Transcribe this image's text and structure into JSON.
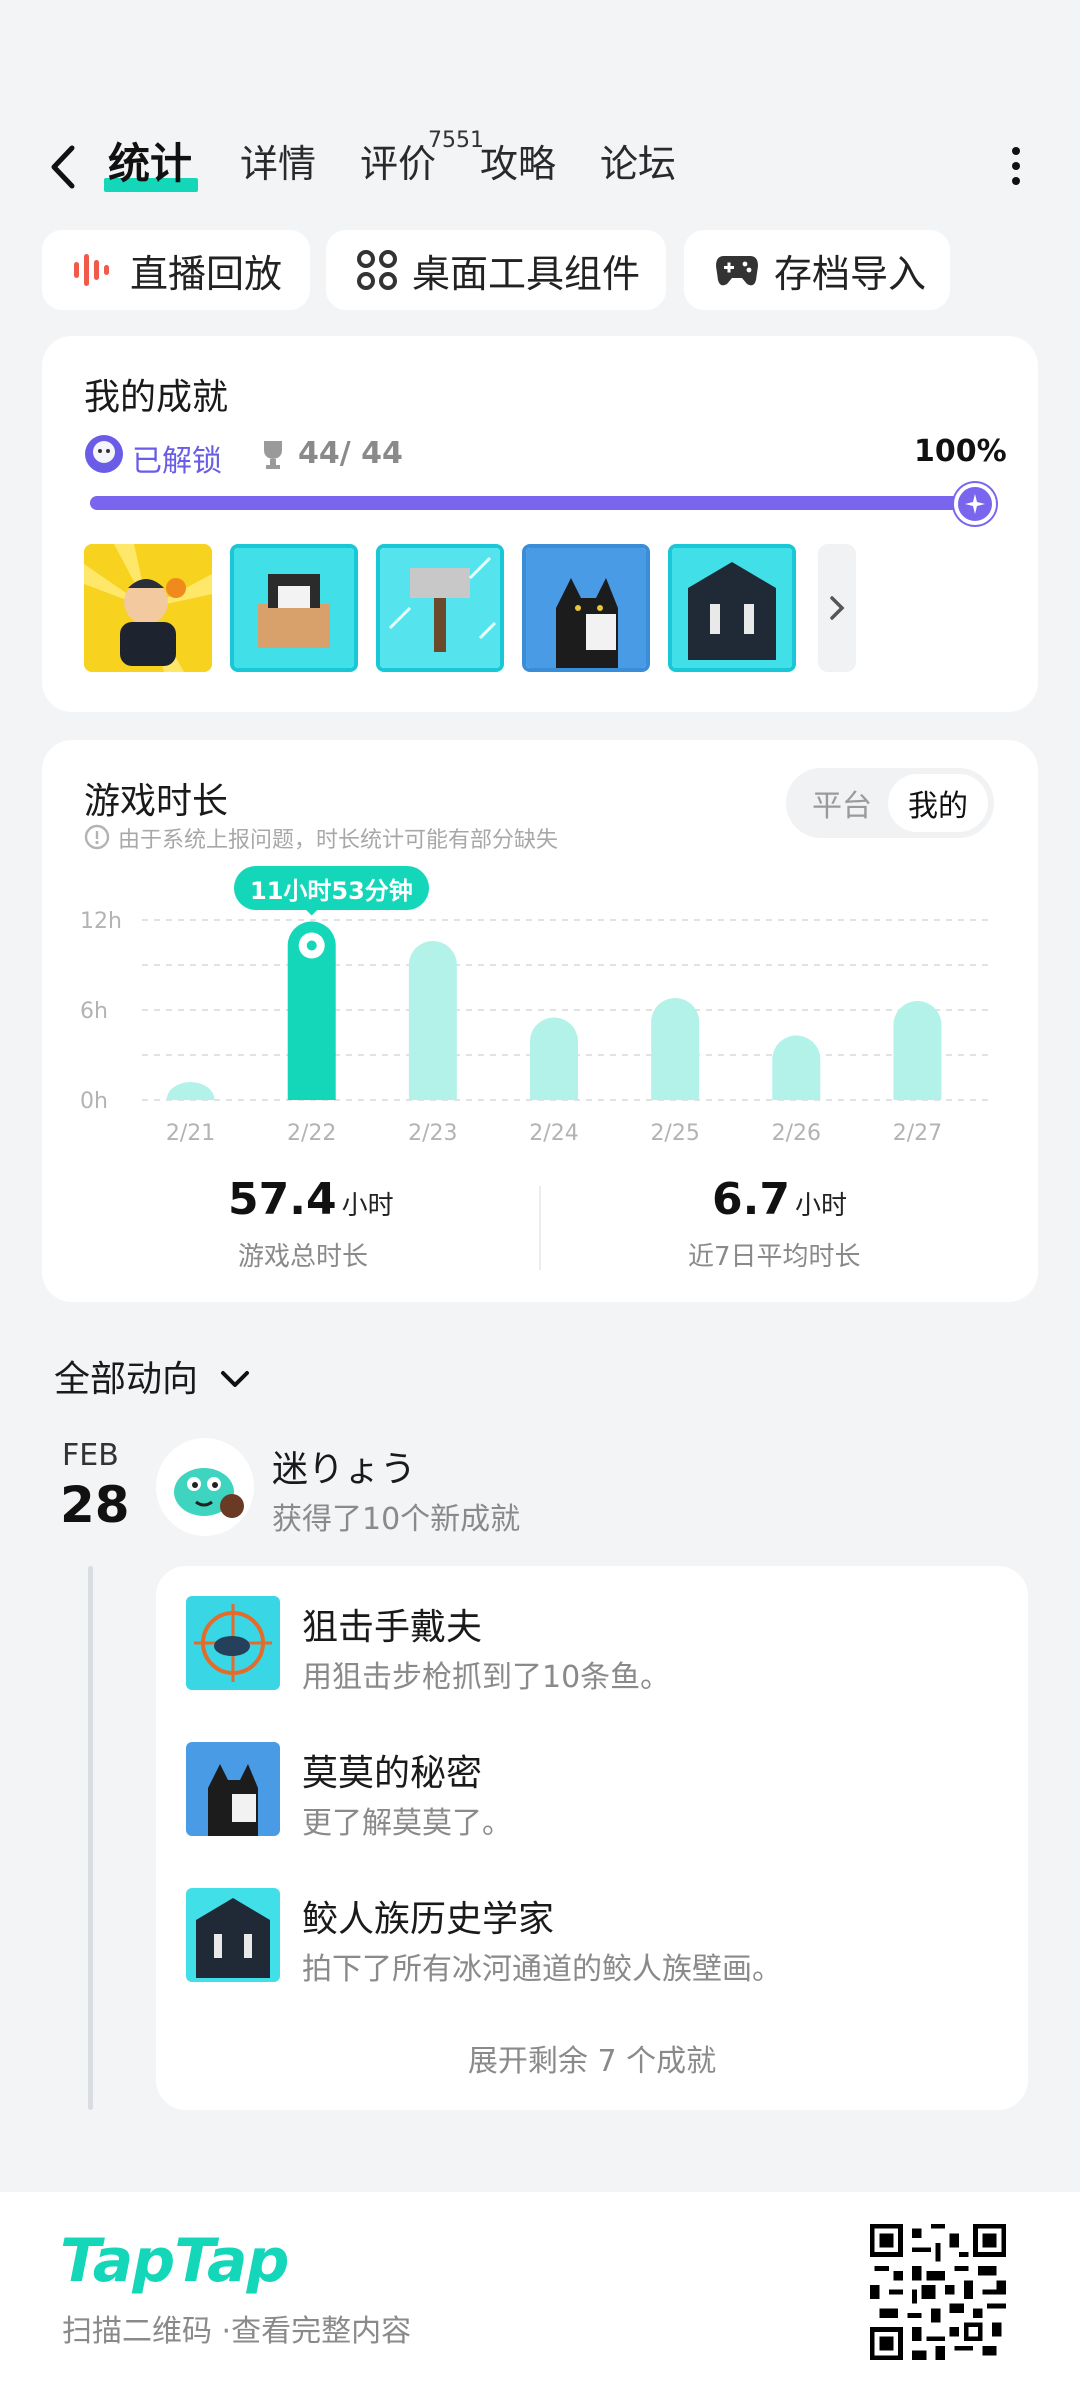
{
  "header": {
    "tabs": [
      {
        "label": "统计"
      },
      {
        "label": "详情"
      },
      {
        "label": "评价"
      },
      {
        "label": "攻略"
      },
      {
        "label": "论坛"
      }
    ],
    "review_count": "7551"
  },
  "chips": [
    {
      "label": "直播回放",
      "icon": "soundwave-icon"
    },
    {
      "label": "桌面工具组件",
      "icon": "widgets-icon"
    },
    {
      "label": "存档导入",
      "icon": "gamepad-icon"
    }
  ],
  "achievements": {
    "title": "我的成就",
    "status": "已解锁",
    "count": "44/ 44",
    "percent_label": "100%",
    "progress": 1.0
  },
  "playtime": {
    "title": "游戏时长",
    "note": "由于系统上报问题，时长统计可能有部分缺失",
    "toggle": {
      "platform": "平台",
      "mine": "我的"
    },
    "tooltip": "11小时53分钟",
    "total_value": "57.4",
    "total_unit": "小时",
    "total_label": "游戏总时长",
    "avg_value": "6.7",
    "avg_unit": "小时",
    "avg_label": "近7日平均时长"
  },
  "chart_data": {
    "type": "bar",
    "categories": [
      "2/21",
      "2/22",
      "2/23",
      "2/24",
      "2/25",
      "2/26",
      "2/27"
    ],
    "values": [
      1.2,
      11.9,
      10.6,
      5.5,
      6.8,
      4.3,
      6.6
    ],
    "yticks": [
      "12h",
      "6h",
      "0h"
    ],
    "ylim": [
      0,
      12
    ],
    "highlight_index": 1,
    "colors": {
      "highlight": "#14d6b8",
      "normal": "#b3f2e8"
    }
  },
  "feed": {
    "filter_label": "全部动向",
    "date_month": "FEB",
    "date_day": "28",
    "user_name": "迷りょう",
    "user_action": "获得了10个新成就",
    "items": [
      {
        "title": "狙击手戴夫",
        "desc": "用狙击步枪抓到了10条鱼。"
      },
      {
        "title": "莫莫的秘密",
        "desc": "更了解莫莫了。"
      },
      {
        "title": "鲛人族历史学家",
        "desc": "拍下了所有冰河通道的鲛人族壁画。"
      }
    ],
    "expand_label": "展开剩余 7 个成就"
  },
  "footer": {
    "logo": "TapTap",
    "text": "扫描二维码 ·查看完整内容"
  }
}
